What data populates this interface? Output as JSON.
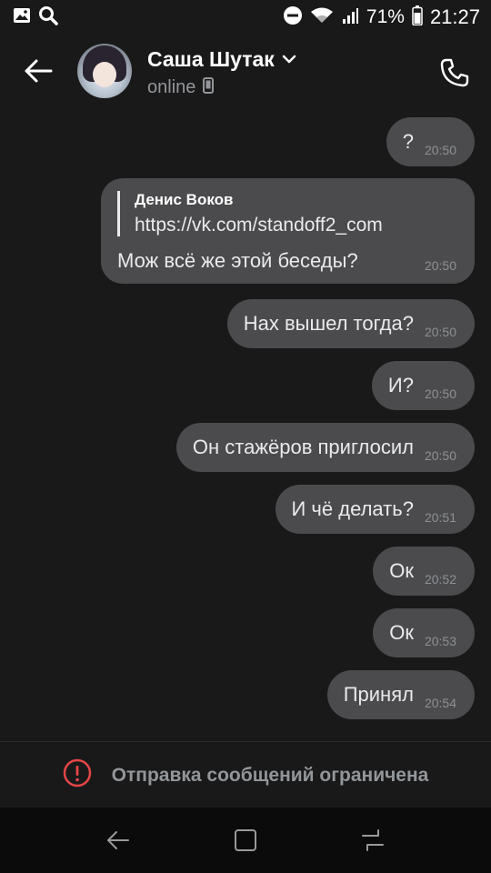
{
  "status_bar": {
    "battery": "71%",
    "time": "21:27",
    "icons": [
      "gallery-icon",
      "search-icon",
      "do-not-disturb-icon",
      "wifi-icon",
      "signal-icon",
      "battery-icon"
    ]
  },
  "header": {
    "name": "Саша Шутак",
    "status": "online",
    "icons": [
      "back-arrow-icon",
      "chevron-down-icon",
      "phone-icon",
      "mobile-device-icon"
    ]
  },
  "messages": [
    {
      "text": "?",
      "time": "20:50"
    },
    {
      "reply_author": "Денис Воков",
      "reply_text": "https://vk.com/standoff2_com",
      "text": "Мож всё же этой беседы?",
      "time": "20:50"
    },
    {
      "text": "Нах вышел тогда?",
      "time": "20:50"
    },
    {
      "text": "И?",
      "time": "20:50"
    },
    {
      "text": "Он стажёров приглосил",
      "time": "20:50"
    },
    {
      "text": "И чё делать?",
      "time": "20:51"
    },
    {
      "text": "Ок",
      "time": "20:52"
    },
    {
      "text": "Ок",
      "time": "20:53"
    },
    {
      "text": "Принял",
      "time": "20:54"
    }
  ],
  "restriction": {
    "text": "Отправка сообщений ограничена",
    "accent": "#e64646"
  },
  "colors": {
    "background": "#19191a",
    "bubble": "#4b4b4d",
    "secondary_text": "#939699"
  }
}
